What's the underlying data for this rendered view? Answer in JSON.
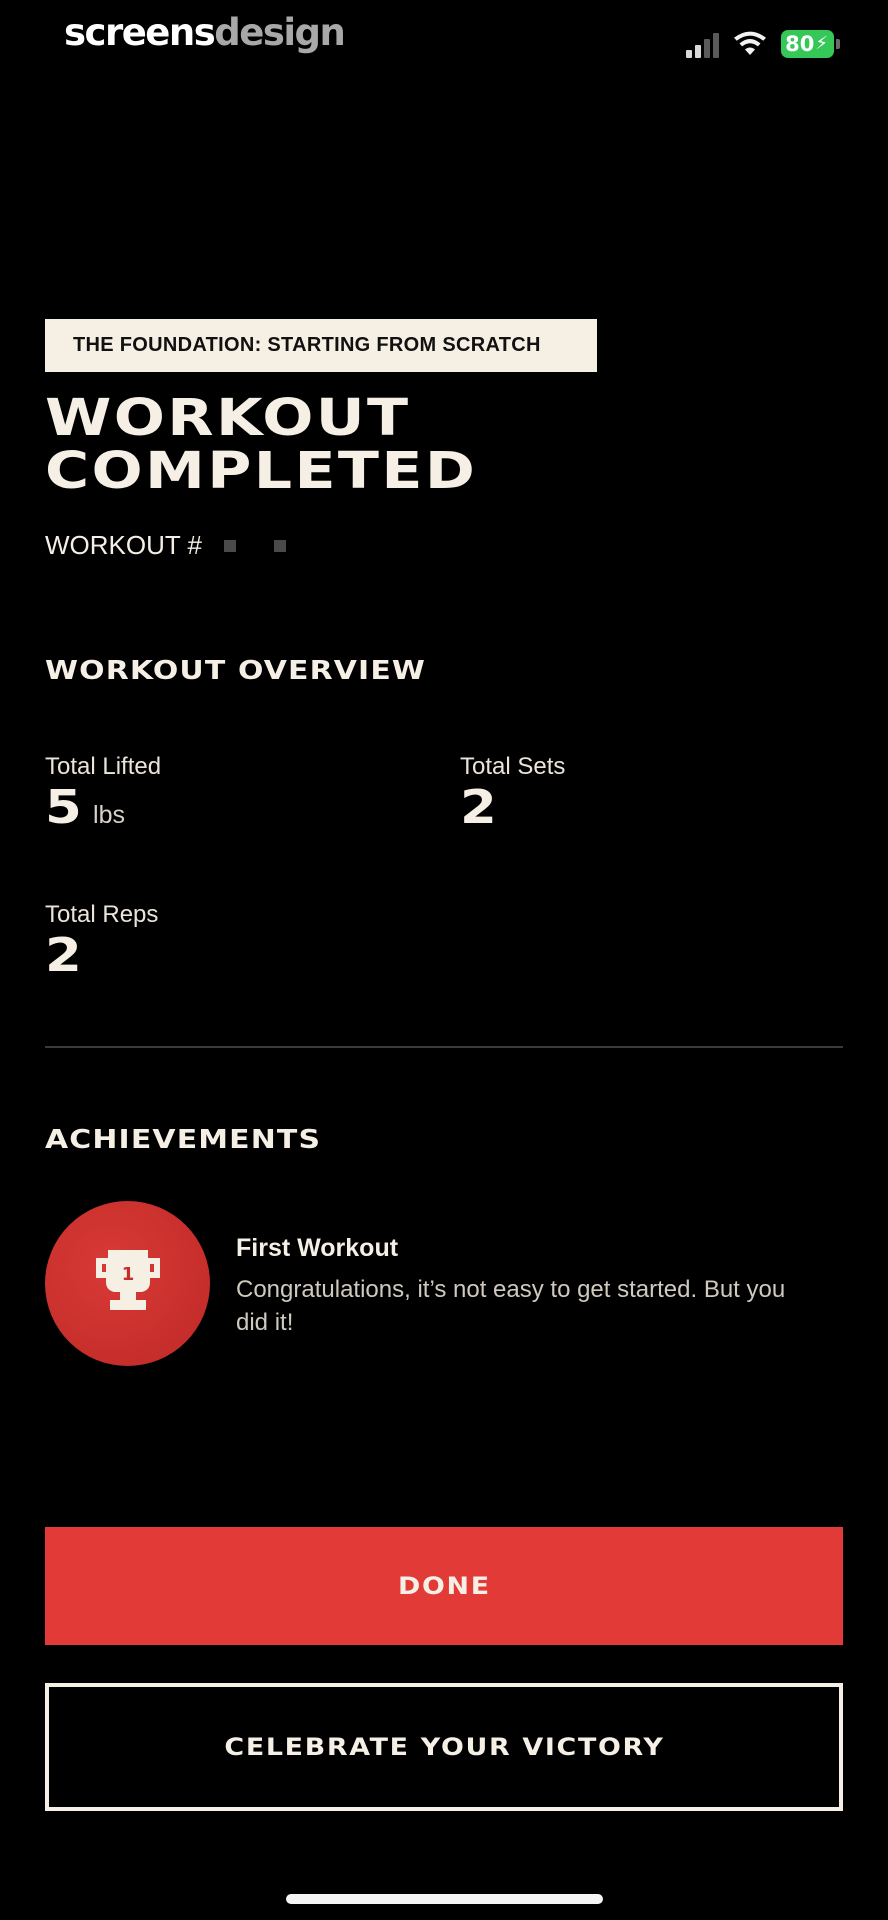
{
  "brand": {
    "part1": "screens",
    "part2": "design"
  },
  "status_bar": {
    "battery_level": "80",
    "battery_color": "#36c759",
    "icons": [
      "signal-icon",
      "wifi-icon",
      "battery-icon",
      "charging-bolt-icon"
    ]
  },
  "plan_tag": "THE FOUNDATION: STARTING FROM SCRATCH",
  "headline": {
    "line1": "WORKOUT",
    "line2": "COMPLETED"
  },
  "workout_number_label": "WORKOUT #",
  "overview": {
    "title": "WORKOUT OVERVIEW",
    "total_lifted": {
      "label": "Total Lifted",
      "value": "5",
      "unit": "lbs"
    },
    "total_sets": {
      "label": "Total Sets",
      "value": "2"
    },
    "total_reps": {
      "label": "Total Reps",
      "value": "2"
    }
  },
  "achievements": {
    "title": "ACHIEVEMENTS",
    "items": [
      {
        "icon": "trophy-icon",
        "badge_number": "1",
        "badge_color": "#c62e2b",
        "title": "First Workout",
        "description": "Congratulations, it’s not easy to get started. But you did it!"
      }
    ]
  },
  "buttons": {
    "done": "DONE",
    "celebrate": "CELEBRATE YOUR VICTORY",
    "done_color": "#e23a36"
  }
}
